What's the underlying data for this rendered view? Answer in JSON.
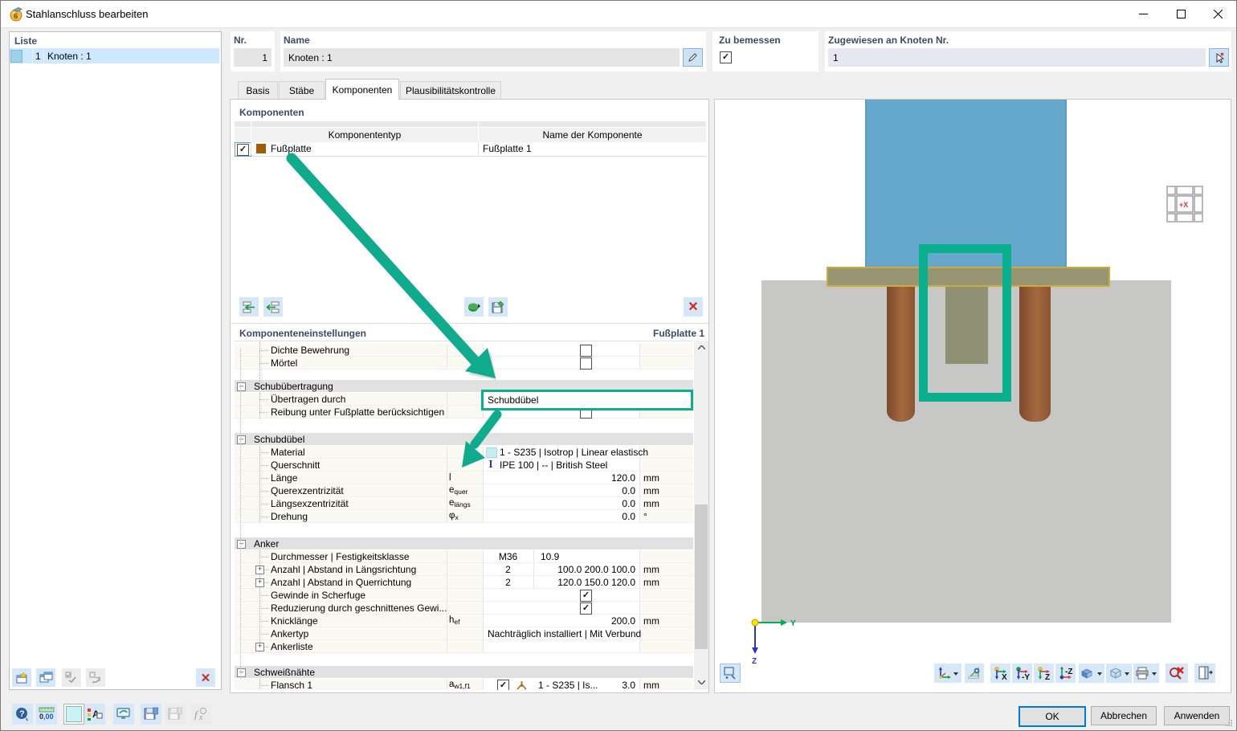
{
  "window": {
    "title": "Stahlanschluss bearbeiten"
  },
  "list_panel": {
    "label": "Liste",
    "item": {
      "num": "1",
      "name": "Knoten : 1"
    }
  },
  "header": {
    "nr_label": "Nr.",
    "nr_value": "1",
    "name_label": "Name",
    "name_value": "Knoten : 1",
    "zu_bemessen_label": "Zu bemessen",
    "zu_bemessen_checked": true,
    "zugewiesen_label": "Zugewiesen an Knoten Nr.",
    "zugewiesen_value": "1"
  },
  "tabs": [
    {
      "label": "Basis",
      "active": false
    },
    {
      "label": "Stäbe",
      "active": false
    },
    {
      "label": "Komponenten",
      "active": true
    },
    {
      "label": "Plausibilitätskontrolle",
      "active": false
    }
  ],
  "components": {
    "section_label": "Komponenten",
    "col_type": "Komponententyp",
    "col_name": "Name der Komponente",
    "rows": [
      {
        "checked": true,
        "type": "Fußplatte",
        "name": "Fußplatte 1",
        "swatch_color": "#a25c03"
      }
    ],
    "toolbar": [
      "insert-row",
      "remove-row",
      "import-component",
      "save-component",
      "delete-component"
    ]
  },
  "settings": {
    "section_label": "Komponenteneinstellungen",
    "section_value": "Fußplatte 1",
    "rows": [
      {
        "kind": "item",
        "label": "Dichte Bewehrung",
        "value": {
          "type": "checkbox",
          "checked": false
        }
      },
      {
        "kind": "item",
        "label": "Mörtel",
        "value": {
          "type": "checkbox",
          "checked": false
        }
      },
      {
        "kind": "gap",
        "h": 13
      },
      {
        "kind": "group",
        "label": "Schubübertragung"
      },
      {
        "kind": "item",
        "label": "Übertragen durch",
        "value": {
          "type": "dropdown",
          "text": "Schubdübel"
        },
        "highlight": true
      },
      {
        "kind": "item",
        "label": "Reibung unter Fußplatte berücksichtigen",
        "value": {
          "type": "checkbox",
          "checked": false
        }
      },
      {
        "kind": "gap",
        "h": 18
      },
      {
        "kind": "group",
        "label": "Schubdübel"
      },
      {
        "kind": "item",
        "label": "Material",
        "value": {
          "type": "icontext",
          "icon": "material-swatch",
          "text": "1 - S235 | Isotrop | Linear elastisch"
        }
      },
      {
        "kind": "item",
        "label": "Querschnitt",
        "value": {
          "type": "icontext",
          "icon": "section-ibeam",
          "text": "IPE 100 | -- | British Steel"
        }
      },
      {
        "kind": "item",
        "label": "Länge",
        "symbol": "l",
        "sub": "",
        "value": {
          "type": "num",
          "num": "120.0",
          "unit": "mm"
        }
      },
      {
        "kind": "item",
        "label": "Querexzentrizität",
        "symbol": "e",
        "sub": "quer",
        "value": {
          "type": "num",
          "num": "0.0",
          "unit": "mm"
        }
      },
      {
        "kind": "item",
        "label": "Längsexzentrizität",
        "symbol": "e",
        "sub": "längs",
        "value": {
          "type": "num",
          "num": "0.0",
          "unit": "mm"
        }
      },
      {
        "kind": "item",
        "label": "Drehung",
        "symbol": "φ",
        "sub": "x",
        "value": {
          "type": "num",
          "num": "0.0",
          "unit": "°"
        }
      },
      {
        "kind": "gap",
        "h": 18
      },
      {
        "kind": "group",
        "label": "Anker"
      },
      {
        "kind": "item",
        "label": "Durchmesser | Festigkeitsklasse",
        "value": {
          "type": "dual",
          "v1": "M36",
          "v2": "10.9",
          "v2align": "left",
          "unit": ""
        }
      },
      {
        "kind": "item",
        "label": "Anzahl | Abstand in Längsrichtung",
        "expander": "plus",
        "value": {
          "type": "dual",
          "v1": "2",
          "v2": "100.0 200.0 100.0",
          "v2align": "right",
          "unit": "mm"
        }
      },
      {
        "kind": "item",
        "label": "Anzahl | Abstand in Querrichtung",
        "expander": "plus",
        "value": {
          "type": "dual",
          "v1": "2",
          "v2": "120.0 150.0 120.0",
          "v2align": "right",
          "unit": "mm"
        }
      },
      {
        "kind": "item",
        "label": "Gewinde in Scherfuge",
        "value": {
          "type": "checkbox",
          "checked": true
        }
      },
      {
        "kind": "item",
        "label": "Reduzierung durch geschnittenes Gewi...",
        "value": {
          "type": "checkbox",
          "checked": true
        }
      },
      {
        "kind": "item",
        "label": "Knicklänge",
        "symbol": "h",
        "sub": "ef",
        "value": {
          "type": "num",
          "num": "200.0",
          "unit": "mm"
        }
      },
      {
        "kind": "item",
        "label": "Ankertyp",
        "value": {
          "type": "text",
          "text": "Nachträglich installiert | Mit Verbund"
        }
      },
      {
        "kind": "item",
        "label": "Ankerliste",
        "expander": "plus",
        "value": {
          "type": "empty"
        }
      },
      {
        "kind": "gap",
        "h": 16
      },
      {
        "kind": "group",
        "label": "Schweißnähte"
      },
      {
        "kind": "item",
        "label": "Flansch 1",
        "symbol": "a",
        "sub": "w1,f1",
        "value": {
          "type": "weld",
          "checked": true,
          "text": "1 - S235 | Is...",
          "num": "3.0",
          "unit": "mm"
        }
      }
    ]
  },
  "annotations": {
    "color": "#0aaf8e"
  },
  "viewport": {
    "axis_y": "Y",
    "axis_z": "Z",
    "navigator_label": "+X",
    "toolbar": [
      {
        "name": "projection-axes",
        "label": "",
        "dropdown": true
      },
      {
        "name": "measure",
        "label": "",
        "dropdown": false
      },
      {
        "name": "view-x",
        "label": "X",
        "dropdown": false
      },
      {
        "name": "view-minus-y",
        "label": "-Y",
        "dropdown": false
      },
      {
        "name": "view-z",
        "label": "Z",
        "dropdown": false
      },
      {
        "name": "view-minus-z",
        "label": "-Z",
        "dropdown": false
      },
      {
        "name": "render-mode",
        "label": "",
        "dropdown": true
      },
      {
        "name": "visibility-mode",
        "label": "",
        "dropdown": true
      },
      {
        "name": "print",
        "label": "",
        "dropdown": true
      },
      {
        "name": "zoom-reset",
        "label": "",
        "dropdown": false
      },
      {
        "name": "panel-toggle",
        "label": "",
        "dropdown": false
      }
    ]
  },
  "list_toolbar": [
    "new-item",
    "copy-item",
    "check-all",
    "uncheck-all",
    "delete-all"
  ],
  "bottom_toolbar": [
    "help",
    "decimal-places",
    "color-swatch",
    "display-properties",
    "screen-settings",
    "save-defaults",
    "save-as-default-disabled",
    "formula-disabled"
  ],
  "buttons": {
    "ok": "OK",
    "cancel": "Abbrechen",
    "apply": "Anwenden"
  }
}
